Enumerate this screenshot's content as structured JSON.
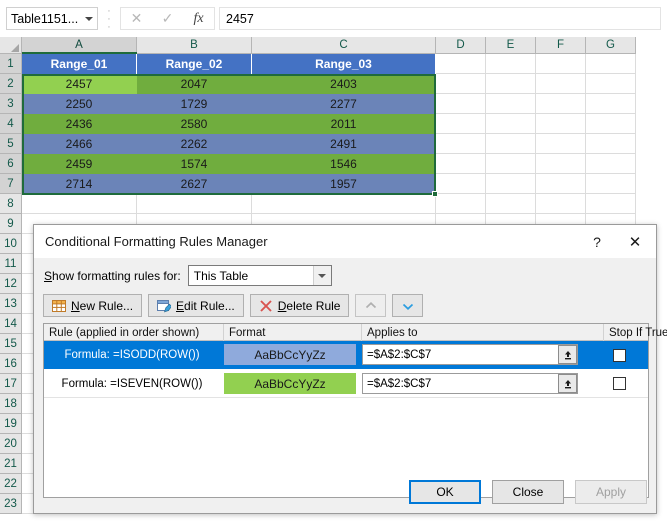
{
  "formula_bar": {
    "name_box_value": "Table1151...",
    "cancel_icon": "cancel-icon",
    "enter_icon": "check-icon",
    "fx_label": "fx",
    "formula_value": "2457"
  },
  "sheet": {
    "columns": [
      "A",
      "B",
      "C",
      "D",
      "E",
      "F",
      "G"
    ],
    "rows": [
      1,
      2,
      3,
      4,
      5,
      6,
      7,
      8,
      9,
      10,
      11,
      12,
      13,
      14,
      15,
      16,
      17,
      18,
      19,
      20,
      21,
      22,
      23
    ],
    "header_row": [
      "Range_01",
      "Range_02",
      "Range_03"
    ],
    "data_rows": [
      [
        "2457",
        "2047",
        "2403"
      ],
      [
        "2250",
        "1729",
        "2277"
      ],
      [
        "2436",
        "2580",
        "2011"
      ],
      [
        "2466",
        "2262",
        "2491"
      ],
      [
        "2459",
        "1574",
        "1546"
      ],
      [
        "2714",
        "2627",
        "1957"
      ]
    ],
    "colors": {
      "header_fill": "#4472C4",
      "odd_fill": "#6B84B8",
      "even_fill": "#70AD3E",
      "active_cell_fill": "#92D050",
      "selection_border": "#1f6b3b"
    },
    "selected_column": "A",
    "active_cell": "A2"
  },
  "dialog": {
    "title": "Conditional Formatting Rules Manager",
    "help_icon": "help-icon",
    "close_icon": "close-icon",
    "show_rules_label": "Show formatting rules for:",
    "show_rules_label_parts": {
      "accel": "S",
      "rest": "how formatting rules for:"
    },
    "scope_value": "This Table",
    "toolbar": {
      "new_rule": "New Rule...",
      "new_rule_accel": "N",
      "new_rule_rest": "ew Rule...",
      "edit_rule": "Edit Rule...",
      "edit_rule_accel": "E",
      "edit_rule_rest": "dit Rule...",
      "delete_rule": "Delete Rule",
      "delete_rule_accel": "D",
      "delete_rule_rest": "elete Rule",
      "move_up": "move-up-arrow",
      "move_down": "move-down-arrow",
      "new_rule_icon": "new-rule-icon",
      "edit_rule_icon": "edit-rule-pencil-icon",
      "delete_rule_icon": "delete-rule-x-icon"
    },
    "list_headers": {
      "rule": "Rule (applied in order shown)",
      "format": "Format",
      "applies_to": "Applies to",
      "stop_if_true": "Stop If True"
    },
    "rules": [
      {
        "rule": "Formula: =ISODD(ROW())",
        "format_preview": "AaBbCcYyZz",
        "format_fill": "#8FAADC",
        "format_text_color": "#1a1a1a",
        "applies_to": "=$A$2:$C$7",
        "stop_if_true": false,
        "selected": true
      },
      {
        "rule": "Formula: =ISEVEN(ROW())",
        "format_preview": "AaBbCcYyZz",
        "format_fill": "#92D050",
        "format_text_color": "#1a1a1a",
        "applies_to": "=$A$2:$C$7",
        "stop_if_true": false,
        "selected": false
      }
    ],
    "collapse_icon": "collapse-dialog-icon",
    "footer": {
      "ok": "OK",
      "close": "Close",
      "apply": "Apply"
    }
  }
}
